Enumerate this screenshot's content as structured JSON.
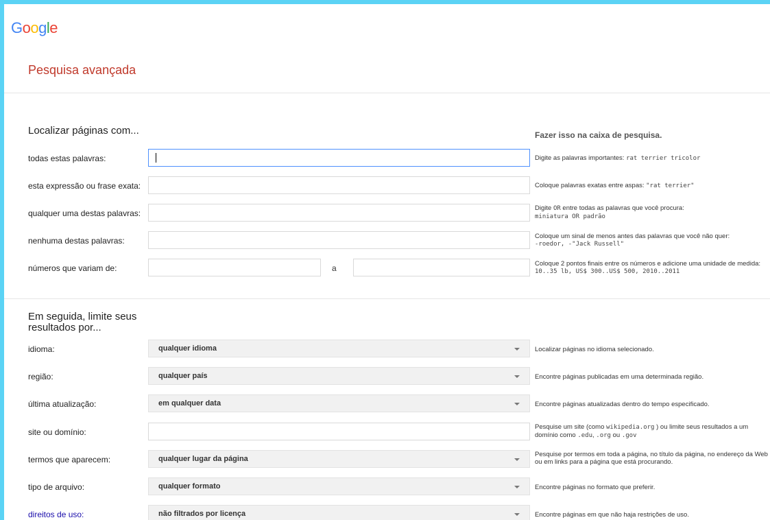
{
  "logo": {
    "letters": [
      "G",
      "o",
      "o",
      "g",
      "l",
      "e"
    ]
  },
  "colors": {
    "logo": [
      "#4285f4",
      "#ea4335",
      "#fbbc05",
      "#4285f4",
      "#34a853",
      "#ea4335"
    ],
    "title": "#c0392b",
    "link": "#1a0dab",
    "focus_border": "#4d90fe"
  },
  "page_title": "Pesquisa avançada",
  "find_section": {
    "title": "Localizar páginas com...",
    "hint_title": "Fazer isso na caixa de pesquisa.",
    "rows": [
      {
        "label": "todas estas palavras:",
        "value": "",
        "hint_text": "Digite as palavras importantes: ",
        "hint_code": "rat terrier tricolor"
      },
      {
        "label": "esta expressão ou frase exata:",
        "value": "",
        "hint_text": "Coloque palavras exatas entre aspas: ",
        "hint_code": "\"rat terrier\""
      },
      {
        "label": "qualquer uma destas palavras:",
        "value": "",
        "hint_pre": "Digite ",
        "hint_or": "OR",
        "hint_post": " entre todas as palavras que você procura:",
        "hint_code": "miniatura OR padrão"
      },
      {
        "label": "nenhuma destas palavras:",
        "value": "",
        "hint_text": "Coloque um sinal de menos antes das palavras que você não quer:",
        "hint_code": "-roedor, -\"Jack Russell\""
      },
      {
        "label": "números que variam de:",
        "from": "",
        "to": "",
        "separator": "a",
        "hint_text": "Coloque 2 pontos finais entre os números e adicione uma unidade de medida: ",
        "hint_code": "10..35 lb, US$ 300..US$ 500, 2010..2011"
      }
    ]
  },
  "narrow_section": {
    "title_line1": "Em seguida, limite seus",
    "title_line2": "resultados por...",
    "rows": [
      {
        "label": "idioma:",
        "selected": "qualquer idioma",
        "hint": "Localizar páginas no idioma selecionado."
      },
      {
        "label": "região:",
        "selected": "qualquer país",
        "hint": "Encontre páginas publicadas em uma determinada região."
      },
      {
        "label": "última atualização:",
        "selected": "em qualquer data",
        "hint": "Encontre páginas atualizadas dentro do tempo especificado."
      },
      {
        "label": "site ou domínio:",
        "value": "",
        "hint_a": "Pesquise um site (como ",
        "hint_code1": "wikipedia.org",
        "hint_b": " ) ou limite seus resultados a um domínio como ",
        "hint_code2": ".edu",
        "hint_c": ", ",
        "hint_code3": ".org",
        "hint_d": " ou ",
        "hint_code4": ".gov"
      },
      {
        "label": "termos que aparecem:",
        "selected": "qualquer lugar da página",
        "hint": "Pesquise por termos em toda a página, no título da página, no endereço da Web ou em links para a página que está procurando."
      },
      {
        "label": "tipo de arquivo:",
        "selected": "qualquer formato",
        "hint": "Encontre páginas no formato que preferir."
      },
      {
        "label": "direitos de uso:",
        "selected": "não filtrados por licença",
        "hint": "Encontre páginas em que não haja restrições de uso."
      }
    ]
  }
}
